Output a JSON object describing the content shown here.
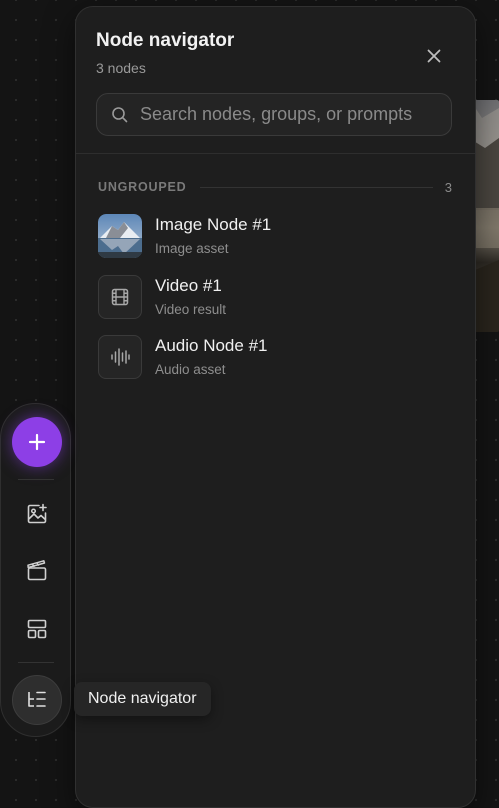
{
  "panel": {
    "title": "Node navigator",
    "subtitle": "3 nodes",
    "search_placeholder": "Search nodes, groups, or prompts",
    "group": {
      "label": "UNGROUPED",
      "count": "3"
    },
    "nodes": [
      {
        "name": "Image Node #1",
        "type": "Image asset",
        "icon": "image-thumbnail"
      },
      {
        "name": "Video #1",
        "type": "Video result",
        "icon": "film-icon"
      },
      {
        "name": "Audio Node #1",
        "type": "Audio asset",
        "icon": "waveform-icon"
      }
    ]
  },
  "toolbar": {
    "items": [
      "plus-icon",
      "image-add-icon",
      "clapperboard-icon",
      "layout-icon",
      "list-tree-icon"
    ]
  },
  "tooltip": {
    "text": "Node navigator"
  },
  "colors": {
    "accent": "#8d3fe6",
    "panel_bg": "#1e1e1e",
    "canvas_bg": "#141414"
  }
}
